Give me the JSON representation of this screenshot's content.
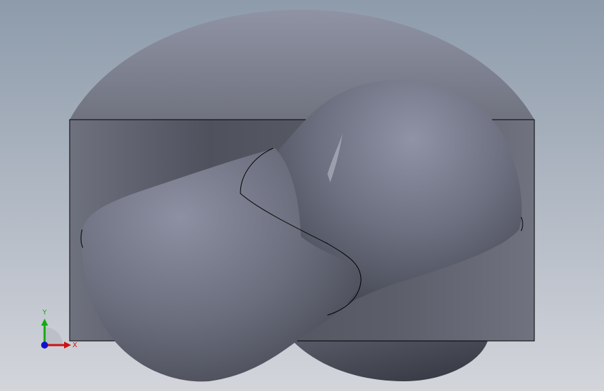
{
  "triad": {
    "x_label": "X",
    "y_label": "Y",
    "x_color": "#cc1111",
    "y_color": "#11aa11",
    "z_color": "#1111cc"
  },
  "colors": {
    "background_top": "#8d9bab",
    "background_bottom": "#d2d4da",
    "part_light": "#8a8da0",
    "part_dark": "#3c3f49",
    "edge": "#000000"
  }
}
